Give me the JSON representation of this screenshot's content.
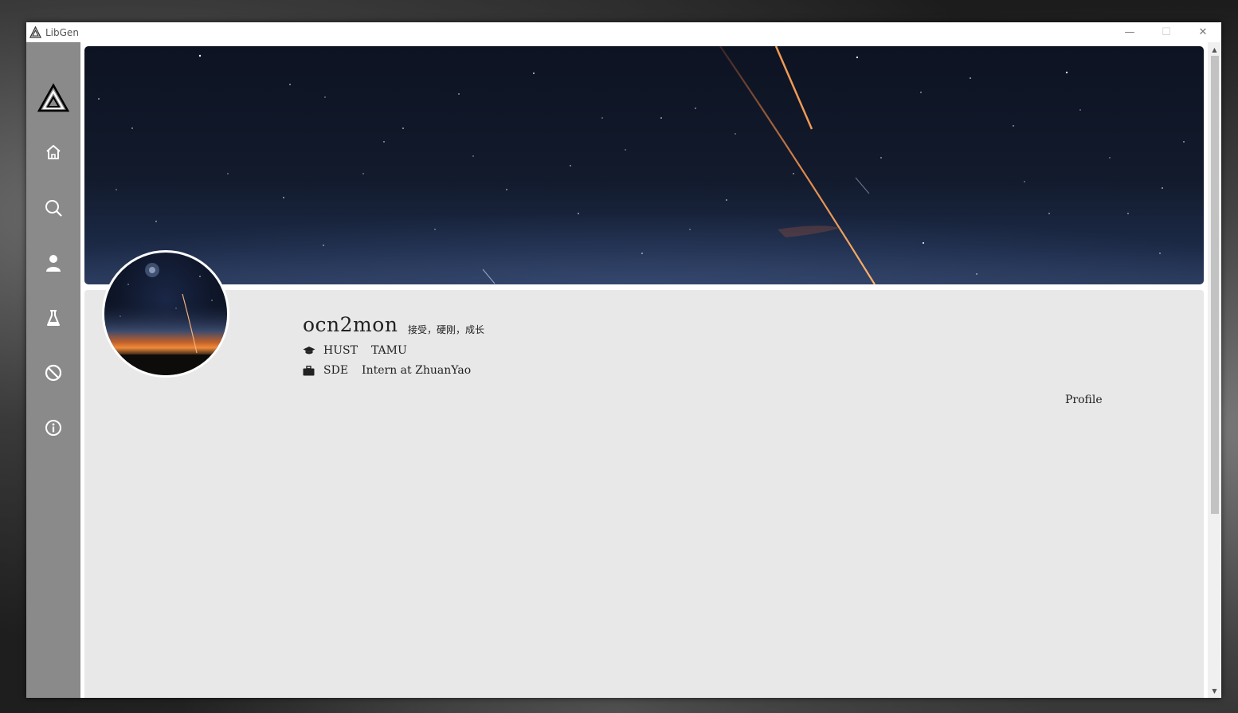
{
  "window": {
    "title": "LibGen",
    "controls": {
      "minimize": "—",
      "maximize": "☐",
      "close": "✕"
    }
  },
  "sidebar": {
    "logo": "libgen-triangle-logo",
    "items": [
      {
        "icon": "home-icon",
        "active": false
      },
      {
        "icon": "search-icon",
        "active": false
      },
      {
        "icon": "user-icon",
        "active": true
      },
      {
        "icon": "flask-icon",
        "active": false
      },
      {
        "icon": "block-icon",
        "active": false
      },
      {
        "icon": "info-icon",
        "active": false
      }
    ],
    "background": "#8a8a8a"
  },
  "profile": {
    "username": "ocn2mon",
    "motto": "接受，硬刚，成长",
    "education": {
      "school1": "HUST",
      "school2": "TAMU"
    },
    "work": {
      "role": "SDE",
      "position": "Intern at ZhuanYao"
    },
    "link": "Profile"
  },
  "colors": {
    "panel": "#e8e8e8",
    "sidebar": "#8a8a8a",
    "text": "#222222"
  }
}
